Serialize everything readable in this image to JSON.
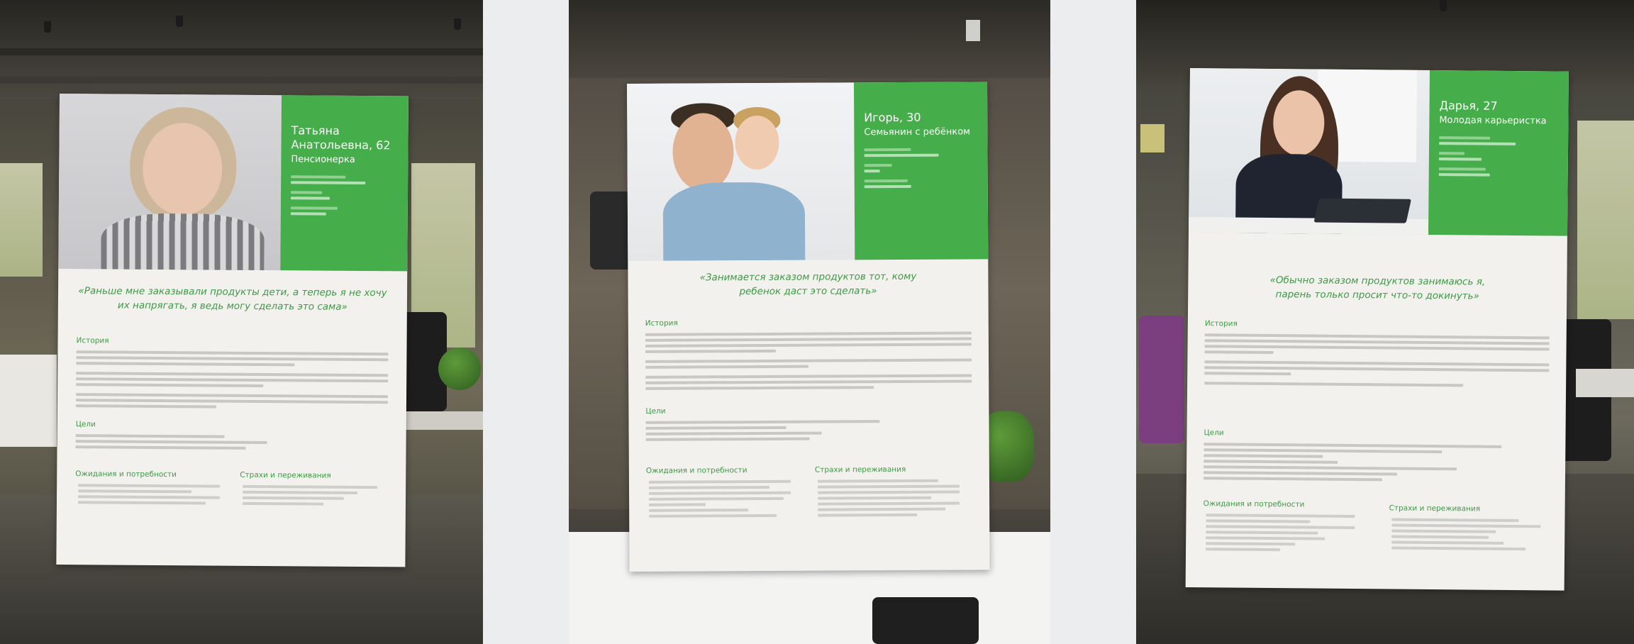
{
  "posters": [
    {
      "name": "Татьяна Анатольевна, 62",
      "role": "Пенсионерка",
      "quote": "«Раньше мне заказывали продукты дети, а теперь я не хочу их напрягать, я ведь могу сделать это сама»",
      "history_title": "История",
      "goals_title": "Цели",
      "expectations_title": "Ожидания и потребности",
      "fears_title": "Страхи и переживания"
    },
    {
      "name": "Игорь, 30",
      "role": "Семьянин с ребёнком",
      "quote": "«Занимается заказом продуктов тот, кому ребенок даст это сделать»",
      "history_title": "История",
      "goals_title": "Цели",
      "expectations_title": "Ожидания и потребности",
      "fears_title": "Страхи и переживания"
    },
    {
      "name": "Дарья, 27",
      "role": "Молодая карьеристка",
      "quote": "«Обычно заказом продуктов занимаюсь я, парень только просит что-то докинуть»",
      "history_title": "История",
      "goals_title": "Цели",
      "expectations_title": "Ожидания и потребности",
      "fears_title": "Страхи и переживания"
    }
  ],
  "colors": {
    "accent_green": "#45ad4a",
    "quote_green": "#3d9a45",
    "poster_paper": "#f3f1ee",
    "divider": "#ecedee"
  }
}
